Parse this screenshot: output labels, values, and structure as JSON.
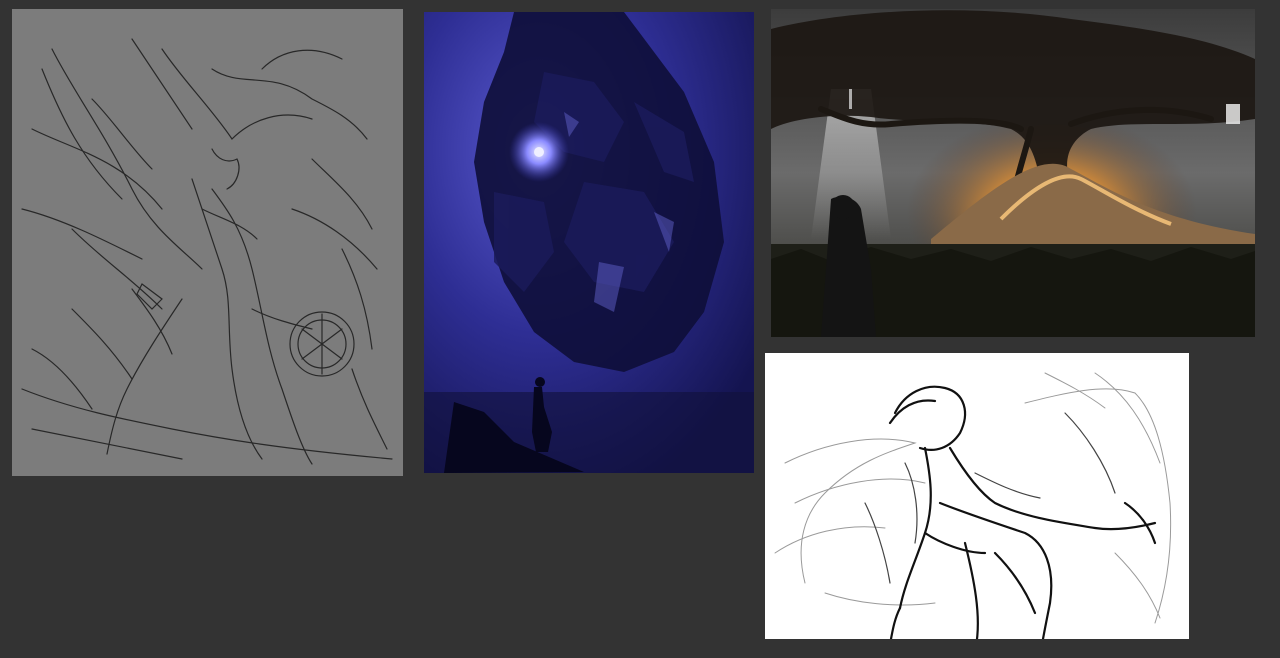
{
  "board": {
    "background": "#333333"
  },
  "panels": [
    {
      "id": "sketch-warrior",
      "kind": "line sketch on grey",
      "background": "#7c7c7c"
    },
    {
      "id": "blue-giant",
      "kind": "blue painted scene",
      "background": "#2a2a80"
    },
    {
      "id": "tree-storm",
      "kind": "stormy tree landscape painting",
      "background": "#4a4a4a"
    },
    {
      "id": "sketch-figure",
      "kind": "line sketch on white",
      "background": "#ffffff"
    }
  ]
}
